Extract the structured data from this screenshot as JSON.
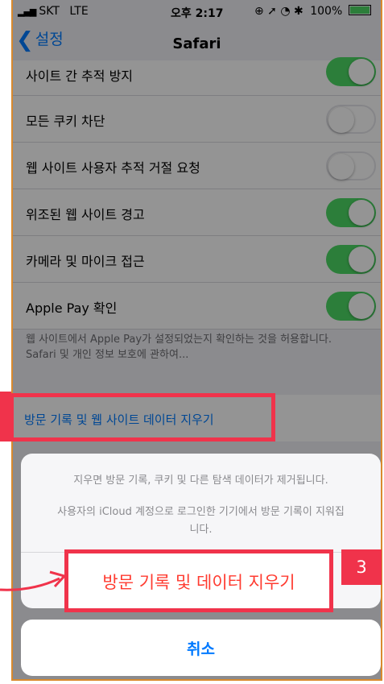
{
  "status_bar": {
    "carrier": "SKT",
    "network": "LTE",
    "time": "오후 2:17",
    "indicators": "⊕ ➚ ◔ ✱",
    "battery": "100%",
    "battery_color": "#4cd964"
  },
  "nav": {
    "back_label": "설정",
    "title": "Safari"
  },
  "settings": [
    {
      "label": "사이트 간 추적 방지",
      "toggle": "on"
    },
    {
      "label": "모든 쿠키 차단",
      "toggle": "off"
    },
    {
      "label": "웹 사이트 사용자 추적 거절 요청",
      "toggle": "off"
    },
    {
      "label": "위조된 웹 사이트 경고",
      "toggle": "on"
    },
    {
      "label": "카메라 및 마이크 접근",
      "toggle": "on"
    },
    {
      "label": "Apple Pay 확인",
      "toggle": "on"
    }
  ],
  "footnote": {
    "text": "웹 사이트에서 Apple Pay가 설정되었는지 확인하는 것을 허용합니다.",
    "link": "Safari 및 개인 정보 보호에 관하여..."
  },
  "clear_history_row": "방문 기록 및 웹 사이트 데이터 지우기",
  "action_sheet": {
    "message_1": "지우면 방문 기록, 쿠키 및 다른 탐색 데이터가 제거됩니다.",
    "message_2": "사용자의 iCloud 계정으로 로그인한 기기에서 방문 기록이 지워집니다.",
    "destructive_label": "방문 기록 및 데이터 지우기",
    "cancel_label": "취소"
  },
  "annotation": {
    "step_number": "3",
    "highlight_color": "#f0334b"
  }
}
